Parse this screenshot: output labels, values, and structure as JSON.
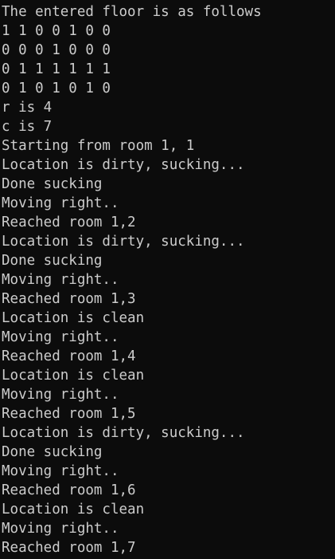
{
  "colors": {
    "background": "#0c0c0c",
    "foreground": "#cccccc"
  },
  "terminal": {
    "lines": [
      "The entered floor is as follows",
      "1 1 0 0 1 0 0",
      "0 0 0 1 0 0 0",
      "0 1 1 1 1 1 1",
      "0 1 0 1 0 1 0",
      "r is 4",
      "c is 7",
      "Starting from room 1, 1",
      "Location is dirty, sucking...",
      "Done sucking",
      "Moving right..",
      "Reached room 1,2",
      "Location is dirty, sucking...",
      "Done sucking",
      "Moving right..",
      "Reached room 1,3",
      "Location is clean",
      "Moving right..",
      "Reached room 1,4",
      "Location is clean",
      "Moving right..",
      "Reached room 1,5",
      "Location is dirty, sucking...",
      "Done sucking",
      "Moving right..",
      "Reached room 1,6",
      "Location is clean",
      "Moving right..",
      "Reached room 1,7"
    ]
  }
}
